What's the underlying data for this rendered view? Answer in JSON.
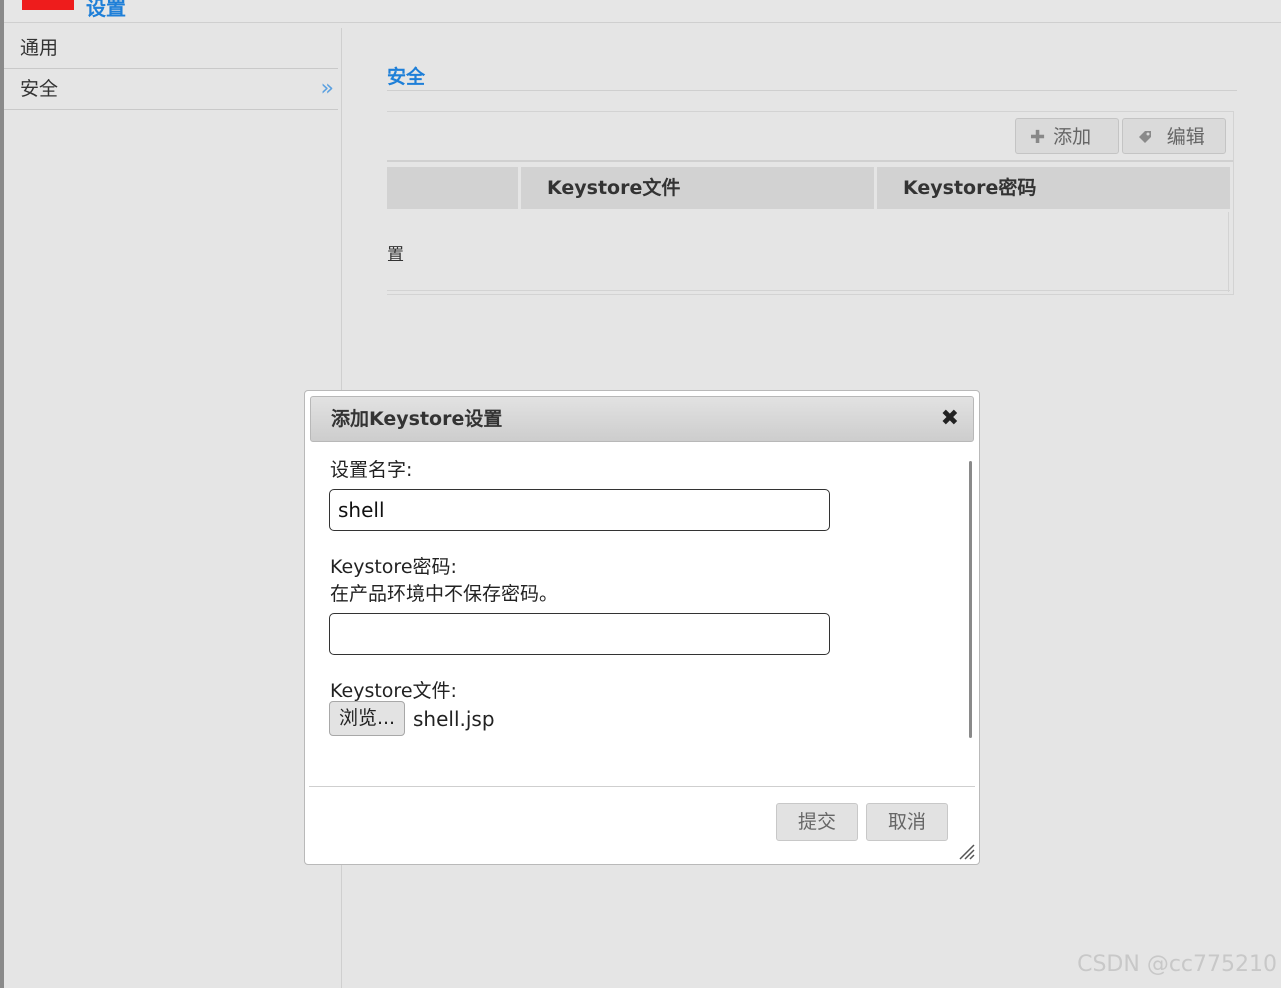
{
  "app": {
    "title": "设置",
    "logo_color": "#ee1c1c"
  },
  "sidebar": {
    "items": [
      {
        "label": "通用"
      },
      {
        "label": "安全",
        "chevron": "»"
      }
    ]
  },
  "main": {
    "section_title": "安全",
    "toolbar": {
      "add_label": "添加",
      "add_icon": "+",
      "edit_label": "编辑",
      "edit_icon": "tag-icon"
    },
    "table": {
      "columns": [
        "",
        "Keystore文件",
        "Keystore密码"
      ],
      "row_partial_text": "置"
    }
  },
  "dialog": {
    "title": "添加Keystore设置",
    "close_icon": "✖",
    "name_label": "设置名字:",
    "name_value": "shell",
    "password_label": "Keystore密码:",
    "password_note": "在产品环境中不保存密码。",
    "password_value": "",
    "file_label": "Keystore文件:",
    "browse_label": "浏览...",
    "file_name": "shell.jsp",
    "submit_label": "提交",
    "cancel_label": "取消"
  },
  "watermark": "CSDN @cc775210"
}
